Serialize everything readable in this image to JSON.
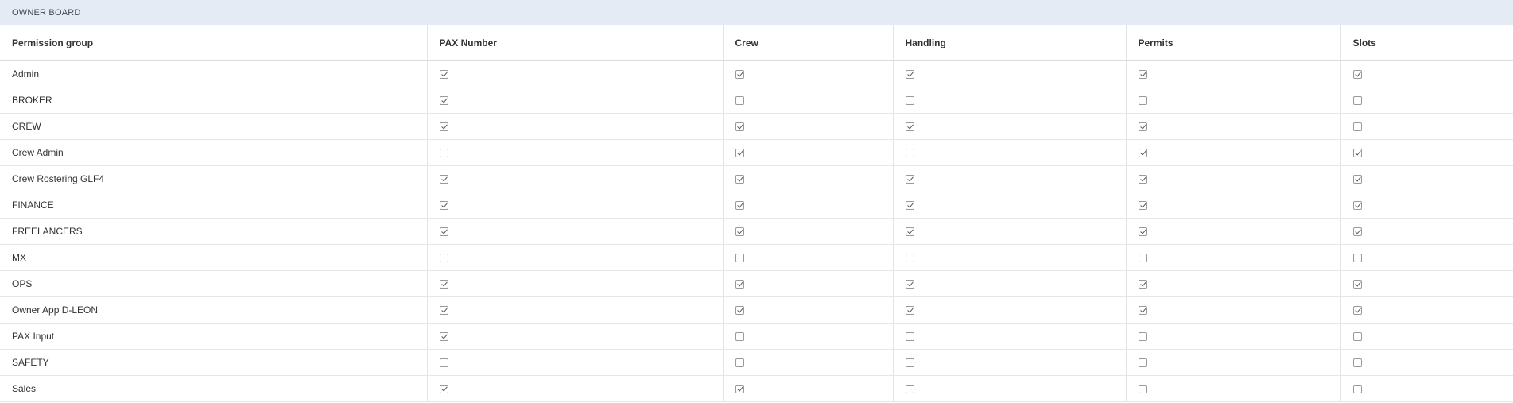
{
  "panel": {
    "title": "OWNER BOARD"
  },
  "table": {
    "columns": [
      "Permission group",
      "PAX Number",
      "Crew",
      "Handling",
      "Permits",
      "Slots"
    ],
    "rows": [
      {
        "name": "Admin",
        "perms": [
          true,
          true,
          true,
          true,
          true
        ]
      },
      {
        "name": "BROKER",
        "perms": [
          true,
          false,
          false,
          false,
          false
        ]
      },
      {
        "name": "CREW",
        "perms": [
          true,
          true,
          true,
          true,
          false
        ]
      },
      {
        "name": "Crew Admin",
        "perms": [
          false,
          true,
          false,
          true,
          true
        ]
      },
      {
        "name": "Crew Rostering GLF4",
        "perms": [
          true,
          true,
          true,
          true,
          true
        ]
      },
      {
        "name": "FINANCE",
        "perms": [
          true,
          true,
          true,
          true,
          true
        ]
      },
      {
        "name": "FREELANCERS",
        "perms": [
          true,
          true,
          true,
          true,
          true
        ]
      },
      {
        "name": "MX",
        "perms": [
          false,
          false,
          false,
          false,
          false
        ]
      },
      {
        "name": "OPS",
        "perms": [
          true,
          true,
          true,
          true,
          true
        ]
      },
      {
        "name": "Owner App D-LEON",
        "perms": [
          true,
          true,
          true,
          true,
          true
        ]
      },
      {
        "name": "PAX Input",
        "perms": [
          true,
          false,
          false,
          false,
          false
        ]
      },
      {
        "name": "SAFETY",
        "perms": [
          false,
          false,
          false,
          false,
          false
        ]
      },
      {
        "name": "Sales",
        "perms": [
          true,
          true,
          false,
          false,
          false
        ]
      }
    ]
  }
}
